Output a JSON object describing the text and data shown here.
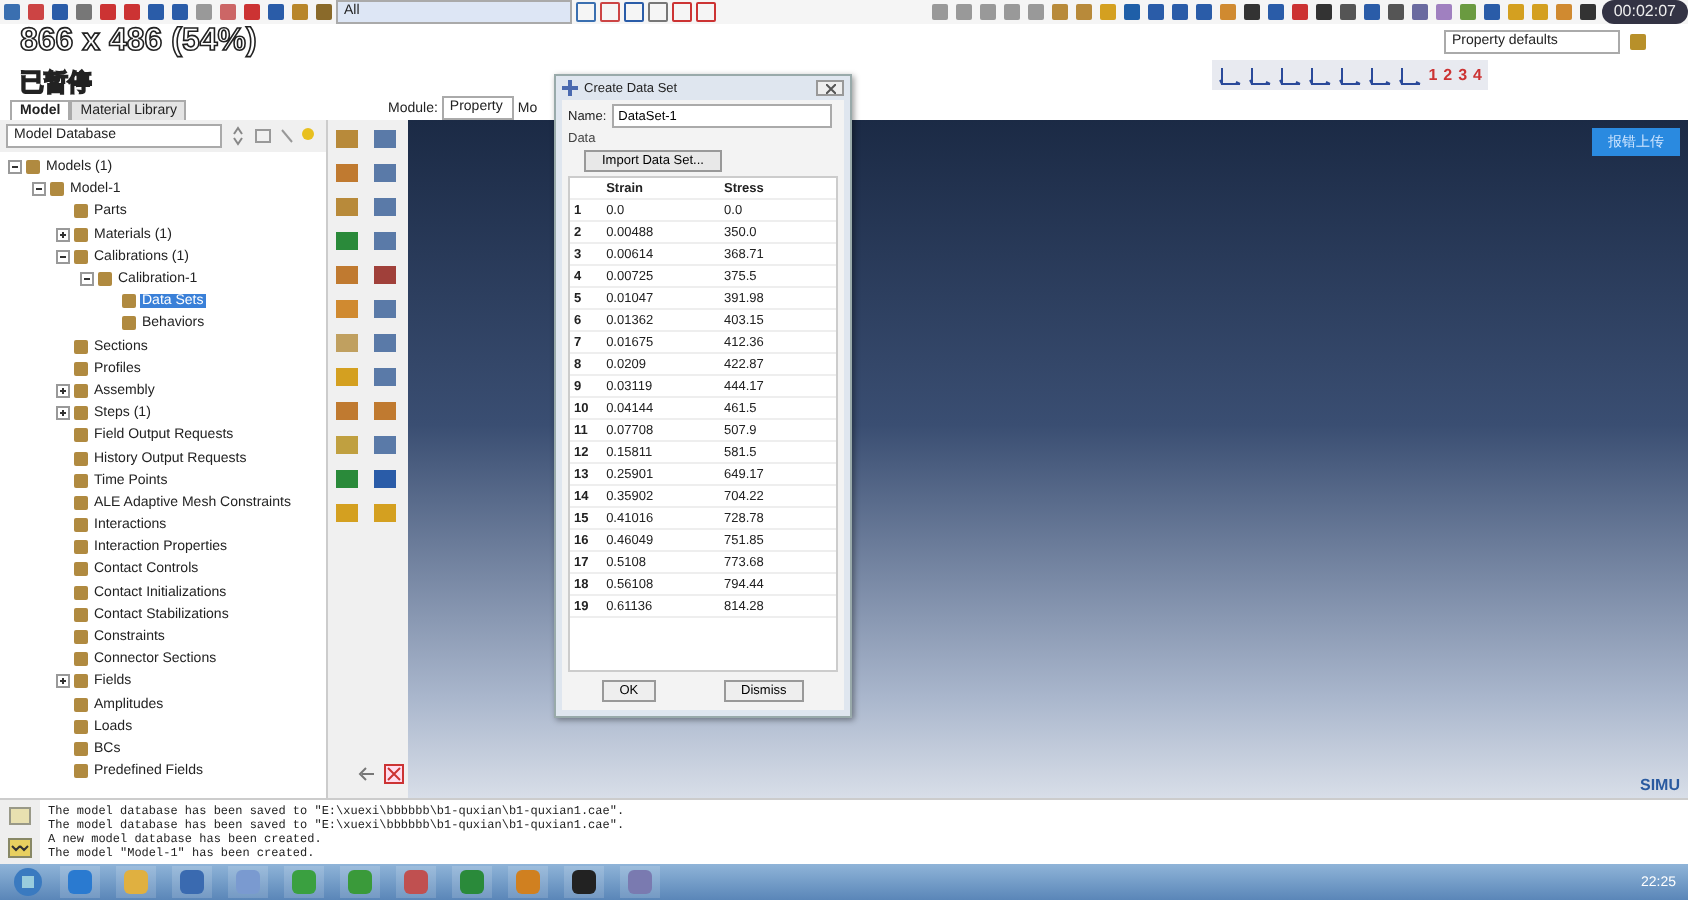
{
  "overlay": {
    "size": "866 x 486 (54%)",
    "status": "已暂停",
    "timer": "00:02:07"
  },
  "toolbar": {
    "selection": "All",
    "defaults": "Property defaults",
    "numbers": [
      "1",
      "2",
      "3",
      "4"
    ]
  },
  "tabs": [
    {
      "label": "Model",
      "selected": true
    },
    {
      "label": "Material Library",
      "selected": false
    }
  ],
  "module": {
    "label": "Module:",
    "value": "Property",
    "next_label": "Mo"
  },
  "tree_source": "Model Database",
  "tree": [
    {
      "label": "Models (1)",
      "expanded": true,
      "selected": false,
      "children": [
        {
          "label": "Model-1",
          "expanded": true,
          "selected": false,
          "children": [
            {
              "label": "Parts",
              "selected": false
            },
            {
              "label": "Materials (1)",
              "expanded": false,
              "selected": false
            },
            {
              "label": "Calibrations (1)",
              "expanded": true,
              "selected": false,
              "children": [
                {
                  "label": "Calibration-1",
                  "expanded": true,
                  "selected": false,
                  "children": [
                    {
                      "label": "Data Sets",
                      "selected": true
                    },
                    {
                      "label": "Behaviors",
                      "selected": false
                    }
                  ]
                }
              ]
            },
            {
              "label": "Sections",
              "selected": false
            },
            {
              "label": "Profiles",
              "selected": false
            },
            {
              "label": "Assembly",
              "expanded": false,
              "selected": false
            },
            {
              "label": "Steps (1)",
              "expanded": false,
              "selected": false
            },
            {
              "label": "Field Output Requests",
              "selected": false
            },
            {
              "label": "History Output Requests",
              "selected": false
            },
            {
              "label": "Time Points",
              "selected": false
            },
            {
              "label": "ALE Adaptive Mesh Constraints",
              "selected": false
            },
            {
              "label": "Interactions",
              "selected": false
            },
            {
              "label": "Interaction Properties",
              "selected": false
            },
            {
              "label": "Contact Controls",
              "selected": false
            },
            {
              "label": "Contact Initializations",
              "selected": false
            },
            {
              "label": "Contact Stabilizations",
              "selected": false
            },
            {
              "label": "Constraints",
              "selected": false
            },
            {
              "label": "Connector Sections",
              "selected": false
            },
            {
              "label": "Fields",
              "expanded": false,
              "selected": false
            },
            {
              "label": "Amplitudes",
              "selected": false
            },
            {
              "label": "Loads",
              "selected": false
            },
            {
              "label": "BCs",
              "selected": false
            },
            {
              "label": "Predefined Fields",
              "selected": false
            }
          ]
        }
      ]
    }
  ],
  "dialog": {
    "title": "Create Data Set",
    "name_label": "Name:",
    "name_value": "DataSet-1",
    "group_label": "Data",
    "import_button": "Import Data Set...",
    "columns": [
      "",
      "Strain",
      "Stress"
    ],
    "rows": [
      [
        "1",
        "0.0",
        "0.0"
      ],
      [
        "2",
        "0.00488",
        "350.0"
      ],
      [
        "3",
        "0.00614",
        "368.71"
      ],
      [
        "4",
        "0.00725",
        "375.5"
      ],
      [
        "5",
        "0.01047",
        "391.98"
      ],
      [
        "6",
        "0.01362",
        "403.15"
      ],
      [
        "7",
        "0.01675",
        "412.36"
      ],
      [
        "8",
        "0.0209",
        "422.87"
      ],
      [
        "9",
        "0.03119",
        "444.17"
      ],
      [
        "10",
        "0.04144",
        "461.5"
      ],
      [
        "11",
        "0.07708",
        "507.9"
      ],
      [
        "12",
        "0.15811",
        "581.5"
      ],
      [
        "13",
        "0.25901",
        "649.17"
      ],
      [
        "14",
        "0.35902",
        "704.22"
      ],
      [
        "15",
        "0.41016",
        "728.78"
      ],
      [
        "16",
        "0.46049",
        "751.85"
      ],
      [
        "17",
        "0.5108",
        "773.68"
      ],
      [
        "18",
        "0.56108",
        "794.44"
      ],
      [
        "19",
        "0.61136",
        "814.28"
      ]
    ],
    "buttons": [
      "OK",
      "Dismiss"
    ]
  },
  "upload_button": "报错上传",
  "logo_text": "SIMU",
  "messages": [
    "The model database has been saved to \"E:\\xuexi\\bbbbbb\\b1-quxian\\b1-quxian1.cae\".",
    "The model database has been saved to \"E:\\xuexi\\bbbbbb\\b1-quxian\\b1-quxian1.cae\".",
    "A new model database has been created.",
    "The model \"Model-1\" has been created."
  ],
  "taskbar": {
    "clock": "22:25"
  }
}
